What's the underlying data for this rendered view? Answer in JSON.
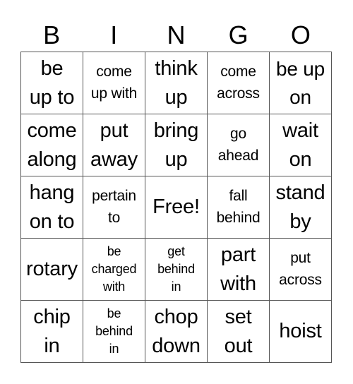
{
  "header": {
    "letters": [
      "B",
      "I",
      "N",
      "G",
      "O"
    ]
  },
  "card": {
    "rows": [
      [
        {
          "text": "be\nup to",
          "size": "s-xl"
        },
        {
          "text": "come\nup with",
          "size": "s-sm"
        },
        {
          "text": "think\nup",
          "size": "s-xl"
        },
        {
          "text": "come\nacross",
          "size": "s-sm"
        },
        {
          "text": "be up\non",
          "size": "s-lg"
        }
      ],
      [
        {
          "text": "come\nalong",
          "size": "s-xl"
        },
        {
          "text": "put\naway",
          "size": "s-xl"
        },
        {
          "text": "bring\nup",
          "size": "s-xl"
        },
        {
          "text": "go\nahead",
          "size": "s-sm"
        },
        {
          "text": "wait\non",
          "size": "s-xl"
        }
      ],
      [
        {
          "text": "hang\non to",
          "size": "s-xl"
        },
        {
          "text": "pertain\nto",
          "size": "s-sm"
        },
        {
          "text": "Free!",
          "size": "s-xl"
        },
        {
          "text": "fall\nbehind",
          "size": "s-sm"
        },
        {
          "text": "stand\nby",
          "size": "s-xl"
        }
      ],
      [
        {
          "text": "rotary",
          "size": "s-xl"
        },
        {
          "text": "be\ncharged\nwith",
          "size": "s-xs"
        },
        {
          "text": "get\nbehind\nin",
          "size": "s-xs"
        },
        {
          "text": "part\nwith",
          "size": "s-xl"
        },
        {
          "text": "put\nacross",
          "size": "s-sm"
        }
      ],
      [
        {
          "text": "chip\nin",
          "size": "s-xl"
        },
        {
          "text": "be\nbehind\nin",
          "size": "s-xs"
        },
        {
          "text": "chop\ndown",
          "size": "s-xl"
        },
        {
          "text": "set\nout",
          "size": "s-xl"
        },
        {
          "text": "hoist",
          "size": "s-xl"
        }
      ]
    ]
  }
}
